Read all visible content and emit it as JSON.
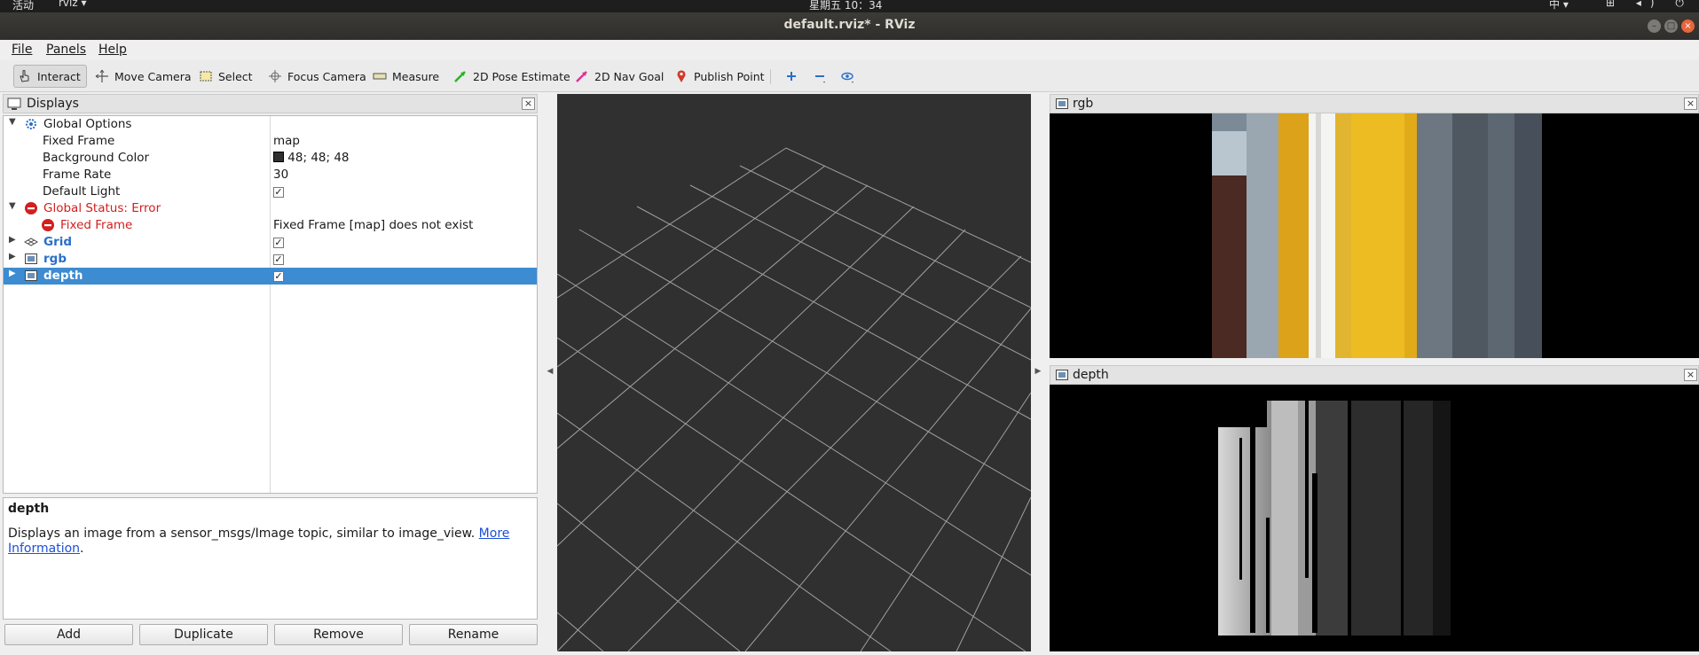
{
  "topbar": {
    "activities": "活动",
    "app_name": "rviz ▾",
    "clock": "星期五 10：34",
    "input_method": "中 ▾",
    "tray_icons": "⊞ ◂) ⏻ ▾"
  },
  "window": {
    "title": "default.rviz* - RViz"
  },
  "menu": {
    "file": "File",
    "panels": "Panels",
    "help": "Help"
  },
  "toolbar": {
    "interact": "Interact",
    "move_camera": "Move Camera",
    "select": "Select",
    "focus_camera": "Focus Camera",
    "measure": "Measure",
    "pose_estimate": "2D Pose Estimate",
    "nav_goal": "2D Nav Goal",
    "publish_point": "Publish Point"
  },
  "displays_panel": {
    "title": "Displays",
    "close": "×",
    "tree": {
      "global_options": "Global Options",
      "fixed_frame_label": "Fixed Frame",
      "fixed_frame_value": "map",
      "background_color_label": "Background Color",
      "background_color_value": "48; 48; 48",
      "background_color_swatch": "#303030",
      "frame_rate_label": "Frame Rate",
      "frame_rate_value": "30",
      "default_light_label": "Default Light",
      "global_status": "Global Status: Error",
      "status_fixed_frame": "Fixed Frame",
      "status_fixed_frame_msg": "Fixed Frame [map] does not exist",
      "grid": "Grid",
      "rgb": "rgb",
      "depth": "depth",
      "check": "✓"
    },
    "description": {
      "title": "depth",
      "text": "Displays an image from a sensor_msgs/Image topic, similar to image_view. ",
      "link_part1": "More",
      "link_part2": "Information",
      "period": "."
    },
    "buttons": {
      "add": "Add",
      "duplicate": "Duplicate",
      "remove": "Remove",
      "rename": "Rename"
    }
  },
  "image_panels": {
    "rgb": {
      "title": "rgb",
      "close": "×"
    },
    "depth": {
      "title": "depth",
      "close": "×"
    }
  },
  "colors": {
    "view_background": "#303030",
    "grid_line": "#a0a0a0",
    "selection": "#3d8bd1",
    "error": "#d21f1f"
  }
}
